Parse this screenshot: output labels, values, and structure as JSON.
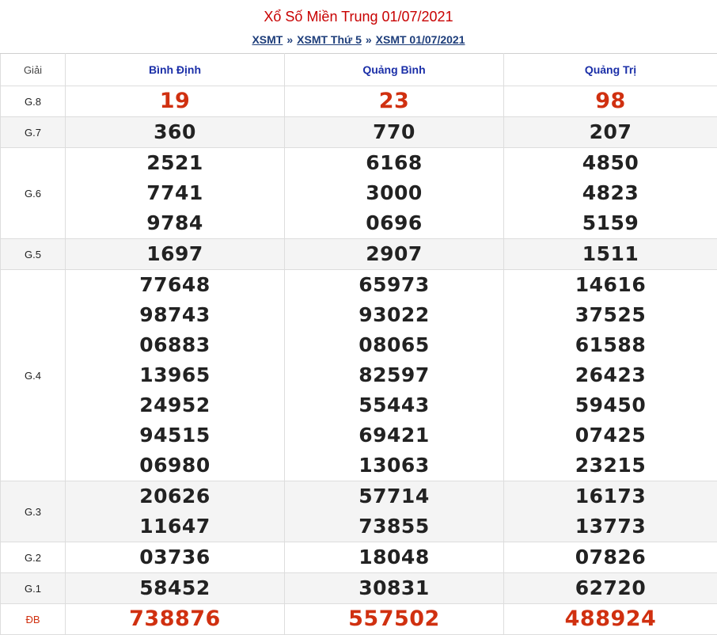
{
  "header": {
    "title": "Xổ Số Miền Trung 01/07/2021",
    "crumbs": [
      "XSMT",
      "XSMT Thứ 5",
      "XSMT 01/07/2021"
    ],
    "separator": "»"
  },
  "table": {
    "prize_header": "Giải",
    "provinces": [
      "Bình Định",
      "Quảng Bình",
      "Quảng Trị"
    ],
    "rows": [
      {
        "prize": "G.8",
        "values": [
          [
            "19"
          ],
          [
            "23"
          ],
          [
            "98"
          ]
        ]
      },
      {
        "prize": "G.7",
        "values": [
          [
            "360"
          ],
          [
            "770"
          ],
          [
            "207"
          ]
        ]
      },
      {
        "prize": "G.6",
        "values": [
          [
            "2521",
            "7741",
            "9784"
          ],
          [
            "6168",
            "3000",
            "0696"
          ],
          [
            "4850",
            "4823",
            "5159"
          ]
        ]
      },
      {
        "prize": "G.5",
        "values": [
          [
            "1697"
          ],
          [
            "2907"
          ],
          [
            "1511"
          ]
        ]
      },
      {
        "prize": "G.4",
        "values": [
          [
            "77648",
            "98743",
            "06883",
            "13965",
            "24952",
            "94515",
            "06980"
          ],
          [
            "65973",
            "93022",
            "08065",
            "82597",
            "55443",
            "69421",
            "13063"
          ],
          [
            "14616",
            "37525",
            "61588",
            "26423",
            "59450",
            "07425",
            "23215"
          ]
        ]
      },
      {
        "prize": "G.3",
        "values": [
          [
            "20626",
            "11647"
          ],
          [
            "57714",
            "73855"
          ],
          [
            "16173",
            "13773"
          ]
        ]
      },
      {
        "prize": "G.2",
        "values": [
          [
            "03736"
          ],
          [
            "18048"
          ],
          [
            "07826"
          ]
        ]
      },
      {
        "prize": "G.1",
        "values": [
          [
            "58452"
          ],
          [
            "30831"
          ],
          [
            "62720"
          ]
        ]
      },
      {
        "prize": "ĐB",
        "values": [
          [
            "738876"
          ],
          [
            "557502"
          ],
          [
            "488924"
          ]
        ]
      }
    ]
  },
  "colors": {
    "title": "#c80000",
    "link": "#1d3d7a",
    "province": "#1b2fa8",
    "highlight_number": "#d03010"
  }
}
